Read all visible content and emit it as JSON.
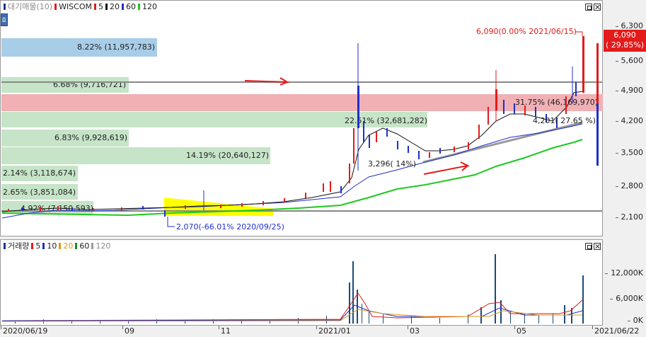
{
  "price_panel": {
    "legend": {
      "title": "대기매물(10)",
      "stock": "WISCOM",
      "ma_items": [
        {
          "label": "5",
          "color": "#e31b1b"
        },
        {
          "label": "20",
          "color": "#111111"
        },
        {
          "label": "60",
          "color": "#1f2fc8"
        },
        {
          "label": "120",
          "color": "#1fc81f"
        }
      ]
    },
    "side_tab_label": "호",
    "high_annotation": "6,090(0.00% 2021/06/15)",
    "low_annotation": "2,070(-66.01% 2020/09/25)",
    "current_price": {
      "price": "6,090",
      "change": "( 29.85%)"
    },
    "y_ticks": [
      "6,300",
      "5,600",
      "4,900",
      "4,200",
      "3,500",
      "2,800",
      "2,100"
    ],
    "volume_zones": [
      {
        "text": "8.22% (11,957,783)",
        "color": "#a8cde8"
      },
      {
        "text": "6.68% (9,716,721)",
        "color": "#c6e4c8"
      },
      {
        "text": "22.51% (32,681,282)",
        "color": "#f0b0b4"
      },
      {
        "text": "6.83% (9,928,619)",
        "color": "#c6e4c8"
      },
      {
        "text": "14.19% (20,640,127)",
        "color": "#c6e4c8"
      },
      {
        "text": "2.14% (3,118,674)",
        "color": "#c6e4c8"
      },
      {
        "text": "2.65% (3,851,084)",
        "color": "#c6e4c8"
      },
      {
        "text": "4.92% (7,150,593)",
        "color": "#c6e4c8"
      },
      {
        "text": "31.75% (46,169,970)",
        "color": "#ffff00"
      }
    ],
    "pattern_labels": [
      "3,296( 14%)",
      "4,201( 27.65 %)"
    ],
    "colors": {
      "up": "#e31b1b",
      "down": "#1f2fc8",
      "support_line": "#888888",
      "trend_line": "#9a9a9a",
      "annotation": "#e31b1b"
    }
  },
  "volume_panel": {
    "legend": {
      "title": "거래량",
      "ma_items": [
        {
          "label": "5",
          "color": "#e31b1b"
        },
        {
          "label": "10",
          "color": "#1f2fc8"
        },
        {
          "label": "20",
          "color": "#d99a1a"
        },
        {
          "label": "60",
          "color": "#1f8a1f"
        },
        {
          "label": "120",
          "color": "#9a9a9a"
        }
      ]
    },
    "y_ticks": [
      "12,000K",
      "6,000K",
      "0K"
    ]
  },
  "x_axis": {
    "ticks": [
      "2020/06/19",
      "09",
      "11",
      "2021/01",
      "03",
      "05",
      "2021/06/22"
    ]
  }
}
